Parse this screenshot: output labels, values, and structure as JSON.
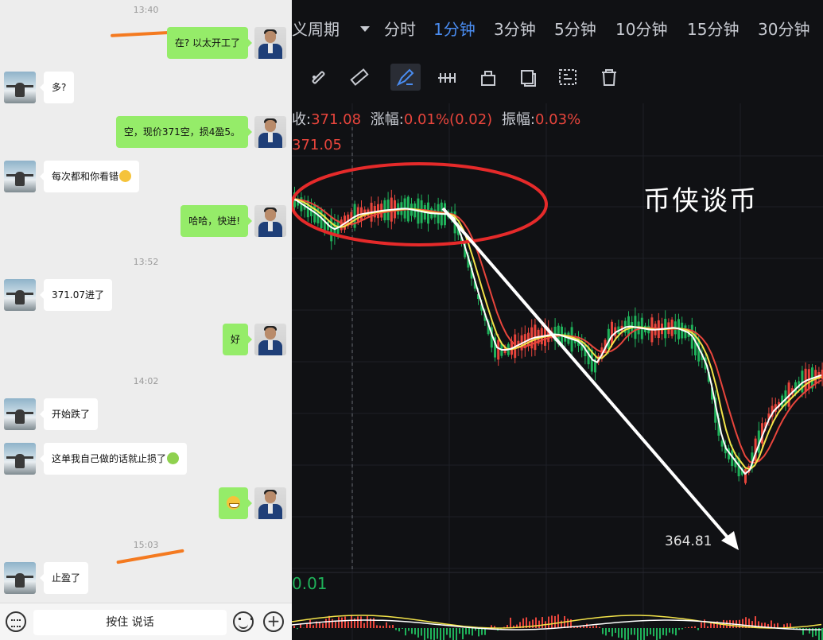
{
  "chat": {
    "timestamps": [
      "13:40",
      "13:52",
      "14:02",
      "15:03"
    ],
    "messages": [
      {
        "from": "me",
        "text": "在? 以太开工了"
      },
      {
        "from": "them",
        "text": "多?"
      },
      {
        "from": "me",
        "text": "空，现价371空，损4盈5。"
      },
      {
        "from": "them",
        "text": "每次都和你看错",
        "emoji": "sad-face"
      },
      {
        "from": "me",
        "text": "哈哈，快进!"
      },
      {
        "from": "them",
        "text": "371.07进了"
      },
      {
        "from": "me",
        "text": "好"
      },
      {
        "from": "them",
        "text": "开始跌了"
      },
      {
        "from": "them",
        "text": "这单我自己做的话就止损了",
        "emoji": "money-face"
      },
      {
        "from": "me",
        "text": "",
        "emoji": "grin-face"
      },
      {
        "from": "them",
        "text": "止盈了"
      }
    ],
    "input_bar": {
      "hold_to_talk": "按住 说话",
      "icons": [
        "keyboard-icon",
        "emoji-icon",
        "plus-icon"
      ]
    },
    "colors": {
      "my_bubble": "#95ec69",
      "their_bubble": "#ffffff",
      "annotation": "#f47a20"
    }
  },
  "chart_app": {
    "periods": [
      "义周期",
      "分时",
      "1分钟",
      "3分钟",
      "5分钟",
      "10分钟",
      "15分钟",
      "30分钟"
    ],
    "active_period": "1分钟",
    "drawing_tools": [
      "magnet-icon",
      "ruler-icon",
      "pen-icon",
      "dots-line-icon",
      "lock-icon",
      "layers-icon",
      "select-icon",
      "trash-icon"
    ],
    "info": {
      "price_label": "收:",
      "price_value": "371.08",
      "change_label": "涨幅:",
      "change_value": "0.01%(0.02)",
      "amplitude_label": "振幅:",
      "amplitude_value": "0.03%"
    },
    "high_label": "371.05",
    "low_label": "364.81",
    "macd_label": "0.01",
    "watermark": "币侠谈币",
    "colors": {
      "up": "#e8453c",
      "down": "#1fb25a",
      "active": "#4a8cf0",
      "ma_white": "#ffffff",
      "ma_yellow": "#f2e34a",
      "ma_red": "#e8453c",
      "annotation_circle": "#e52a2a"
    }
  }
}
